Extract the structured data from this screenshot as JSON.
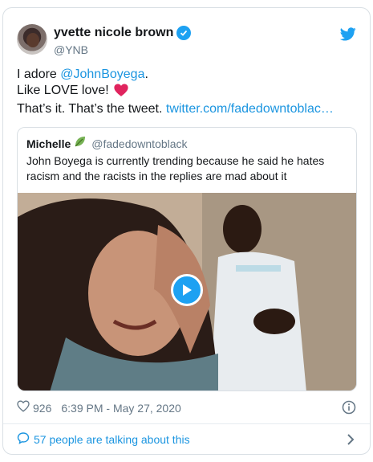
{
  "author": {
    "name": "yvette nicole brown",
    "handle": "@YNB"
  },
  "tweet": {
    "line1_prefix": "I adore ",
    "line1_mention": "@JohnBoyega",
    "line1_suffix": ".",
    "line2": "Like LOVE love!",
    "line3_prefix": "That’s it. That’s the tweet. ",
    "line3_link": "twitter.com/fadedowntoblac…"
  },
  "quoted": {
    "name": "Michelle",
    "handle": "@fadedowntoblack",
    "text": "John Boyega is currently trending because he said he hates racism and the racists in the replies are mad about it"
  },
  "meta": {
    "likes": "926",
    "timestamp": "6:39 PM - May 27, 2020"
  },
  "footer": {
    "talking": "57 people are talking about this"
  },
  "colors": {
    "brand": "#1da1f2",
    "link": "#1b95e0",
    "heart": "#e0245e"
  },
  "icons": [
    "verified-badge-icon",
    "twitter-bird-icon",
    "red-heart-emoji",
    "leaf-emoji",
    "play-icon",
    "heart-outline-icon",
    "info-icon",
    "comment-bubble-icon",
    "chevron-right-icon"
  ]
}
